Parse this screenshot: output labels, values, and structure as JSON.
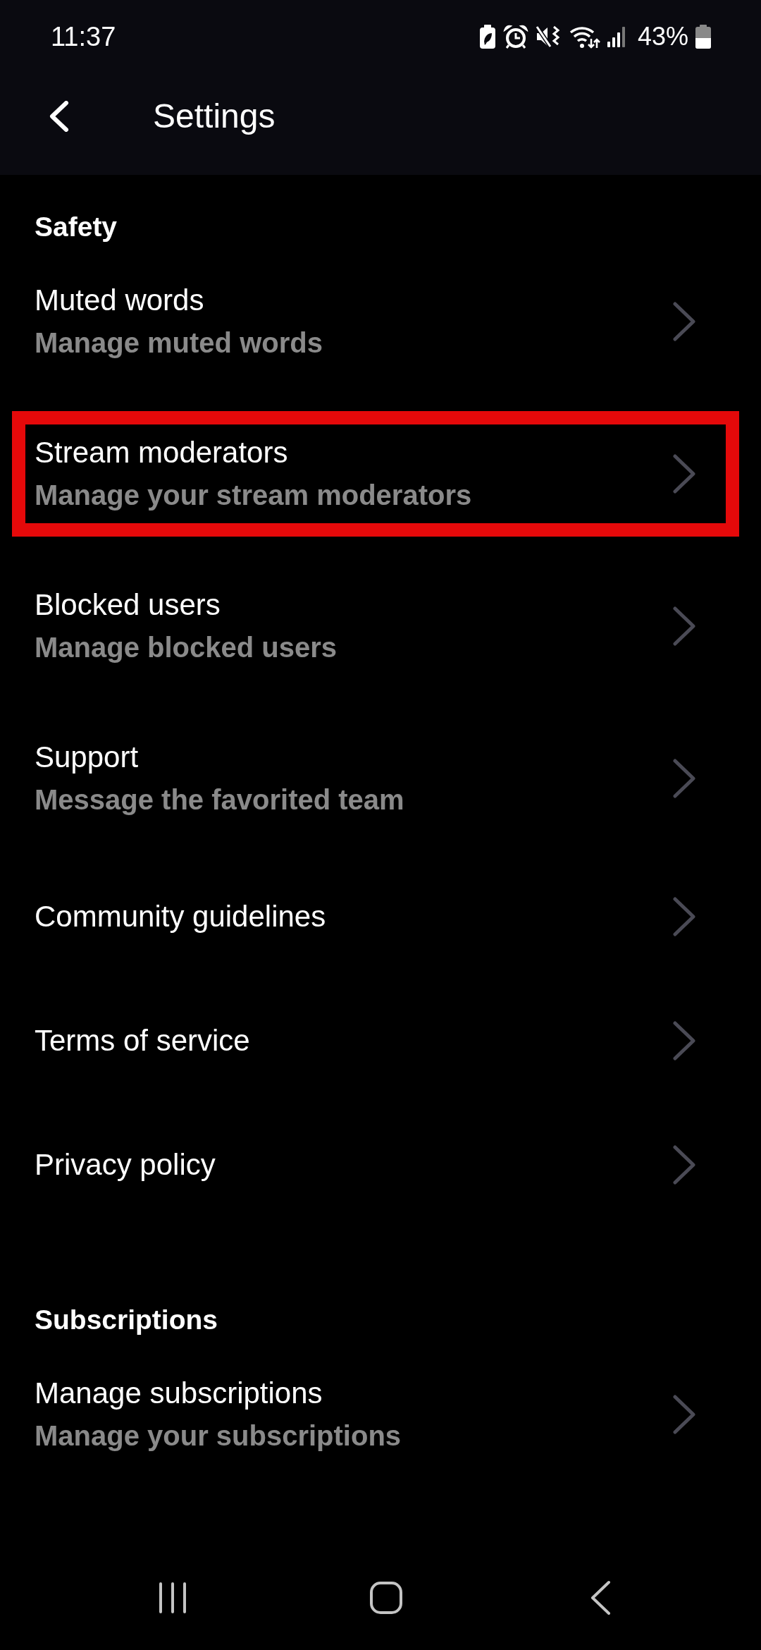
{
  "status_bar": {
    "time": "11:37",
    "battery": "43%"
  },
  "app_bar": {
    "title": "Settings"
  },
  "sections": [
    {
      "title": "Safety",
      "items": [
        {
          "title": "Muted words",
          "subtitle": "Manage muted words",
          "highlighted": false
        },
        {
          "title": "Stream moderators",
          "subtitle": "Manage your stream moderators",
          "highlighted": true
        },
        {
          "title": "Blocked users",
          "subtitle": "Manage blocked users",
          "highlighted": false
        },
        {
          "title": "Support",
          "subtitle": "Message the favorited team",
          "highlighted": false
        },
        {
          "title": "Community guidelines",
          "highlighted": false
        },
        {
          "title": "Terms of service",
          "highlighted": false
        },
        {
          "title": "Privacy policy",
          "highlighted": false
        }
      ]
    },
    {
      "title": "Subscriptions",
      "items": [
        {
          "title": "Manage subscriptions",
          "subtitle": "Manage your subscriptions",
          "highlighted": false
        }
      ]
    }
  ]
}
